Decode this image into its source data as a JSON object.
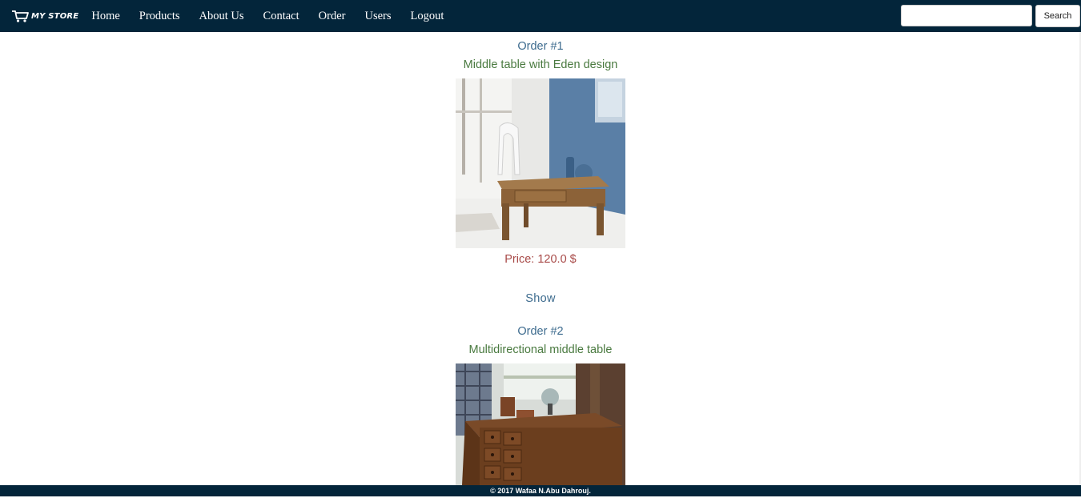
{
  "navbar": {
    "brand_text": "MY STORE",
    "brand_icon": "shopping-cart-icon",
    "links": [
      {
        "label": "Home"
      },
      {
        "label": "Products"
      },
      {
        "label": "About Us"
      },
      {
        "label": "Contact"
      },
      {
        "label": "Order"
      },
      {
        "label": "Users"
      },
      {
        "label": "Logout"
      }
    ],
    "search_value": "",
    "search_button_label": "Search",
    "background_color": "#03253a"
  },
  "orders": [
    {
      "number_label": "Order #1",
      "title": "Middle table with Eden design",
      "price_label": "Price: 120.0 $",
      "show_label": "Show"
    },
    {
      "number_label": "Order #2",
      "title": "Multidirectional middle table"
    }
  ],
  "footer": {
    "text": "© 2017 Wafaa N.Abu Dahrouj."
  },
  "colors": {
    "order_number": "#3d6b8e",
    "order_title": "#4a7a40",
    "price": "#a84a48",
    "link": "#3d6b8e"
  }
}
